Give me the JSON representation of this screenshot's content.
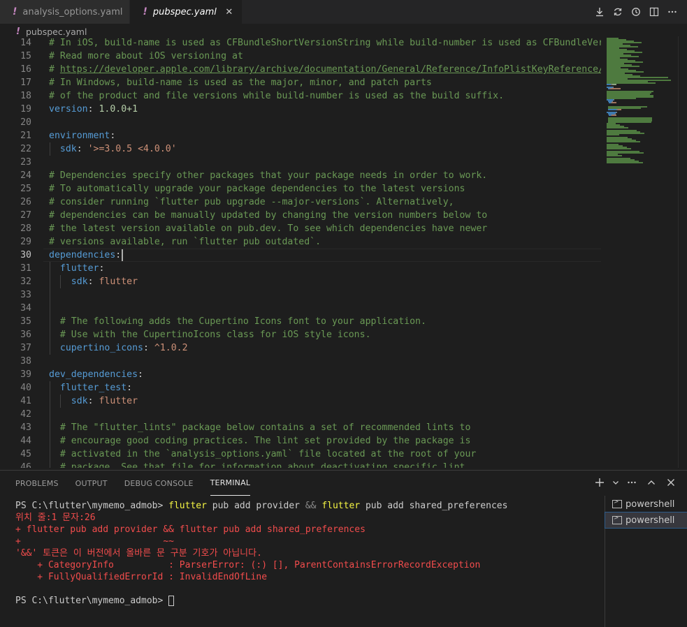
{
  "tabs": [
    {
      "label": "analysis_options.yaml",
      "active": false
    },
    {
      "label": "pubspec.yaml",
      "active": true,
      "close_glyph": "✕"
    }
  ],
  "tab_actions": [
    "download-icon",
    "sync-icon",
    "history-icon",
    "split-editor-icon",
    "more-icon"
  ],
  "breadcrumb": {
    "file": "pubspec.yaml"
  },
  "editor": {
    "lines": [
      {
        "n": "14",
        "tokens": [
          [
            "com",
            "# In iOS, build-name is used as CFBundleShortVersionString while build-number is used as CFBundleVersion"
          ]
        ]
      },
      {
        "n": "15",
        "tokens": [
          [
            "com",
            "# Read more about iOS versioning at"
          ]
        ]
      },
      {
        "n": "16",
        "tokens": [
          [
            "com",
            "# "
          ],
          [
            "link",
            "https://developer.apple.com/library/archive/documentation/General/Reference/InfoPlistKeyReference/Articles"
          ]
        ]
      },
      {
        "n": "17",
        "tokens": [
          [
            "com",
            "# In Windows, build-name is used as the major, minor, and patch parts"
          ]
        ]
      },
      {
        "n": "18",
        "tokens": [
          [
            "com",
            "# of the product and file versions while build-number is used as the build suffix."
          ]
        ]
      },
      {
        "n": "19",
        "tokens": [
          [
            "key",
            "version"
          ],
          [
            "pun",
            ": "
          ],
          [
            "num",
            "1.0.0+1"
          ]
        ]
      },
      {
        "n": "20",
        "tokens": []
      },
      {
        "n": "21",
        "tokens": [
          [
            "key",
            "environment"
          ],
          [
            "pun",
            ":"
          ]
        ]
      },
      {
        "n": "22",
        "tokens": [
          [
            "pun",
            "  "
          ],
          [
            "key",
            "sdk"
          ],
          [
            "pun",
            ": "
          ],
          [
            "str",
            "'>=3.0.5 <4.0.0'"
          ]
        ]
      },
      {
        "n": "23",
        "tokens": []
      },
      {
        "n": "24",
        "tokens": [
          [
            "com",
            "# Dependencies specify other packages that your package needs in order to work."
          ]
        ]
      },
      {
        "n": "25",
        "tokens": [
          [
            "com",
            "# To automatically upgrade your package dependencies to the latest versions"
          ]
        ]
      },
      {
        "n": "26",
        "tokens": [
          [
            "com",
            "# consider running `flutter pub upgrade --major-versions`. Alternatively,"
          ]
        ]
      },
      {
        "n": "27",
        "tokens": [
          [
            "com",
            "# dependencies can be manually updated by changing the version numbers below to"
          ]
        ]
      },
      {
        "n": "28",
        "tokens": [
          [
            "com",
            "# the latest version available on pub.dev. To see which dependencies have newer"
          ]
        ]
      },
      {
        "n": "29",
        "tokens": [
          [
            "com",
            "# versions available, run `flutter pub outdated`."
          ]
        ]
      },
      {
        "n": "30",
        "tokens": [
          [
            "key",
            "dependencies"
          ],
          [
            "pun",
            ":"
          ]
        ],
        "current": true
      },
      {
        "n": "31",
        "tokens": [
          [
            "pun",
            "  "
          ],
          [
            "key",
            "flutter"
          ],
          [
            "pun",
            ":"
          ]
        ]
      },
      {
        "n": "32",
        "tokens": [
          [
            "pun",
            "    "
          ],
          [
            "key",
            "sdk"
          ],
          [
            "pun",
            ": "
          ],
          [
            "str",
            "flutter"
          ]
        ]
      },
      {
        "n": "33",
        "tokens": []
      },
      {
        "n": "34",
        "tokens": []
      },
      {
        "n": "35",
        "tokens": [
          [
            "pun",
            "  "
          ],
          [
            "com",
            "# The following adds the Cupertino Icons font to your application."
          ]
        ]
      },
      {
        "n": "36",
        "tokens": [
          [
            "pun",
            "  "
          ],
          [
            "com",
            "# Use with the CupertinoIcons class for iOS style icons."
          ]
        ]
      },
      {
        "n": "37",
        "tokens": [
          [
            "pun",
            "  "
          ],
          [
            "key",
            "cupertino_icons"
          ],
          [
            "pun",
            ": "
          ],
          [
            "str",
            "^1.0.2"
          ]
        ]
      },
      {
        "n": "38",
        "tokens": []
      },
      {
        "n": "39",
        "tokens": [
          [
            "key",
            "dev_dependencies"
          ],
          [
            "pun",
            ":"
          ]
        ]
      },
      {
        "n": "40",
        "tokens": [
          [
            "pun",
            "  "
          ],
          [
            "key",
            "flutter_test"
          ],
          [
            "pun",
            ":"
          ]
        ]
      },
      {
        "n": "41",
        "tokens": [
          [
            "pun",
            "    "
          ],
          [
            "key",
            "sdk"
          ],
          [
            "pun",
            ": "
          ],
          [
            "str",
            "flutter"
          ]
        ]
      },
      {
        "n": "42",
        "tokens": []
      },
      {
        "n": "43",
        "tokens": [
          [
            "pun",
            "  "
          ],
          [
            "com",
            "# The \"flutter_lints\" package below contains a set of recommended lints to"
          ]
        ]
      },
      {
        "n": "44",
        "tokens": [
          [
            "pun",
            "  "
          ],
          [
            "com",
            "# encourage good coding practices. The lint set provided by the package is"
          ]
        ]
      },
      {
        "n": "45",
        "tokens": [
          [
            "pun",
            "  "
          ],
          [
            "com",
            "# activated in the `analysis_options.yaml` file located at the root of your"
          ]
        ]
      },
      {
        "n": "46",
        "tokens": [
          [
            "pun",
            "  "
          ],
          [
            "com",
            "# package. See that file for information about deactivating specific lint"
          ]
        ]
      }
    ]
  },
  "panel": {
    "tabs": [
      {
        "label": "PROBLEMS",
        "active": false
      },
      {
        "label": "OUTPUT",
        "active": false
      },
      {
        "label": "DEBUG CONSOLE",
        "active": false
      },
      {
        "label": "TERMINAL",
        "active": true
      }
    ],
    "actions": [
      "add-terminal-icon",
      "chevron-down-icon",
      "more-icon",
      "maximize-panel-icon",
      "close-panel-icon"
    ],
    "terminal_lines": [
      [
        [
          "prompt",
          "PS C:\\flutter\\mymemo_admob> "
        ],
        [
          "cmd",
          "flutter"
        ],
        [
          "arg",
          " pub add provider "
        ],
        [
          "op",
          "&&"
        ],
        [
          "arg",
          " "
        ],
        [
          "cmd",
          "flutter"
        ],
        [
          "arg",
          " pub add shared_preferences"
        ]
      ],
      [
        [
          "err",
          "위치 줄:1 문자:26"
        ]
      ],
      [
        [
          "err",
          "+ flutter pub add provider && flutter pub add shared_preferences"
        ]
      ],
      [
        [
          "err",
          "+                          ~~"
        ]
      ],
      [
        [
          "err",
          "'&&' 토큰은 이 버전에서 올바른 문 구분 기호가 아닙니다."
        ]
      ],
      [
        [
          "err",
          "    + CategoryInfo          : ParserError: (:) [], ParentContainsErrorRecordException"
        ]
      ],
      [
        [
          "err",
          "    + FullyQualifiedErrorId : InvalidEndOfLine"
        ]
      ],
      [],
      [
        [
          "prompt",
          "PS C:\\flutter\\mymemo_admob> "
        ]
      ]
    ],
    "terminal_list": [
      {
        "label": "powershell",
        "active": false
      },
      {
        "label": "powershell",
        "active": true
      }
    ]
  },
  "colors": {
    "comment": "#6a9955",
    "key": "#569cd6",
    "string": "#ce9178",
    "number": "#b5cea8",
    "error": "#f14c4c",
    "command": "#f5f543"
  }
}
